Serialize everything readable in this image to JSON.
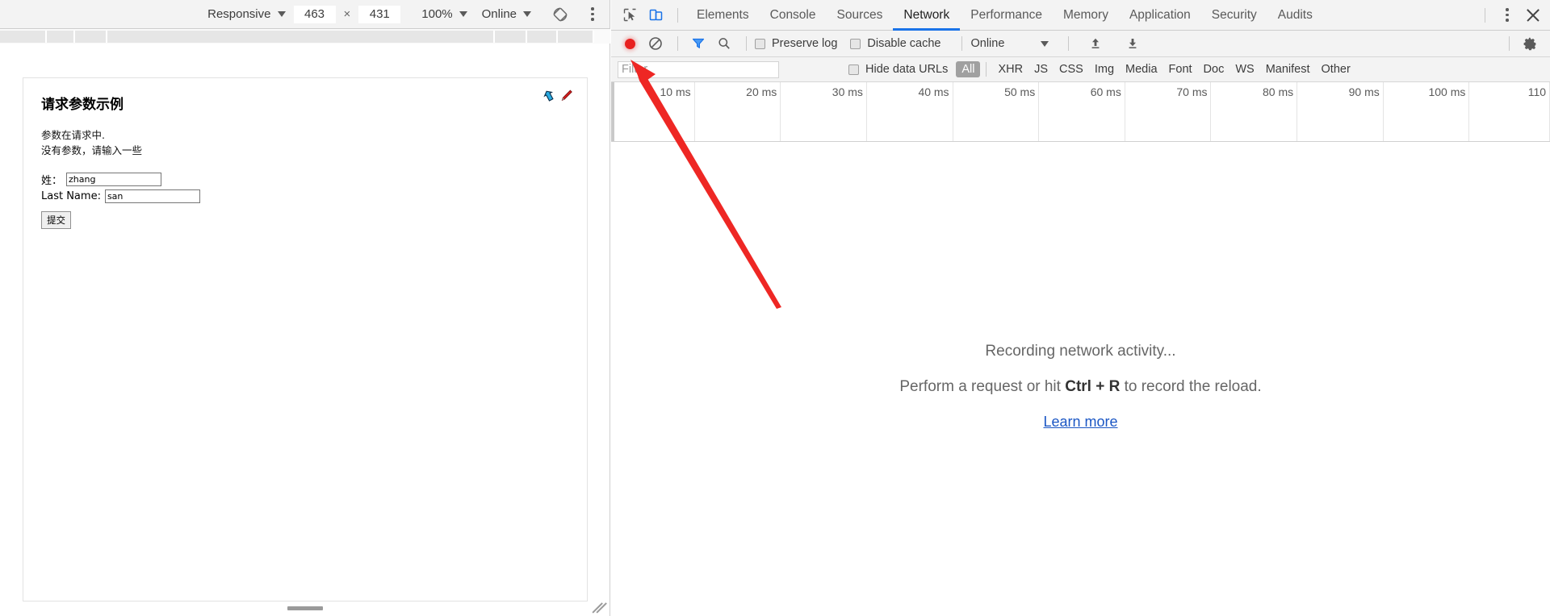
{
  "device_toolbar": {
    "device_label": "Responsive",
    "width": "463",
    "x_sep": "×",
    "height": "431",
    "zoom": "100%",
    "throttle": "Online",
    "rotate_icon": "rotate-device-icon",
    "menu_icon": "more-options-icon"
  },
  "page": {
    "title": "请求参数示例",
    "para_line1": "参数在请求中.",
    "para_line2": "没有参数，请输入一些",
    "fields": [
      {
        "label": "姓：",
        "value": "zhang",
        "name": "first-name"
      },
      {
        "label": "Last Name:",
        "value": "san",
        "name": "last-name"
      }
    ],
    "submit_label": "提交",
    "tool_icons": [
      "undo-arrow-icon",
      "red-pen-icon"
    ]
  },
  "devtools": {
    "inspect_icon": "inspect-element-icon",
    "device_toggle_icon": "toggle-device-toolbar-icon",
    "tabs": [
      {
        "label": "Elements",
        "active": false
      },
      {
        "label": "Console",
        "active": false
      },
      {
        "label": "Sources",
        "active": false
      },
      {
        "label": "Network",
        "active": true
      },
      {
        "label": "Performance",
        "active": false
      },
      {
        "label": "Memory",
        "active": false
      },
      {
        "label": "Application",
        "active": false
      },
      {
        "label": "Security",
        "active": false
      },
      {
        "label": "Audits",
        "active": false
      }
    ],
    "more_tabs_icon": "more-tools-icon",
    "close_icon": "close-devtools-icon"
  },
  "network_toolbar": {
    "record_icon": "record-button-icon",
    "clear_icon": "clear-requests-icon",
    "filter_icon": "filter-toggle-icon",
    "search_icon": "search-icon",
    "preserve_log_label": "Preserve log",
    "preserve_log_checked": false,
    "disable_cache_label": "Disable cache",
    "disable_cache_checked": false,
    "throttle_value": "Online",
    "import_icon": "import-har-icon",
    "export_icon": "export-har-icon",
    "settings_icon": "gear-icon"
  },
  "network_filterbar": {
    "filter_placeholder": "Filter",
    "filter_value": "",
    "hide_data_urls_label": "Hide data URLs",
    "hide_data_urls_checked": false,
    "types": [
      {
        "label": "All",
        "selected": true
      },
      {
        "label": "XHR",
        "selected": false
      },
      {
        "label": "JS",
        "selected": false
      },
      {
        "label": "CSS",
        "selected": false
      },
      {
        "label": "Img",
        "selected": false
      },
      {
        "label": "Media",
        "selected": false
      },
      {
        "label": "Font",
        "selected": false
      },
      {
        "label": "Doc",
        "selected": false
      },
      {
        "label": "WS",
        "selected": false
      },
      {
        "label": "Manifest",
        "selected": false
      },
      {
        "label": "Other",
        "selected": false
      }
    ]
  },
  "timeline": {
    "ticks": [
      "10 ms",
      "20 ms",
      "30 ms",
      "40 ms",
      "50 ms",
      "60 ms",
      "70 ms",
      "80 ms",
      "90 ms",
      "100 ms",
      "110"
    ]
  },
  "network_empty_state": {
    "line1": "Recording network activity...",
    "line2_pre": "Perform a request or hit ",
    "line2_key": "Ctrl + R",
    "line2_post": " to record the reload.",
    "learn_more": "Learn more"
  },
  "annotation": {
    "arrow_color": "#ee2724",
    "arrow_name": "red-pointer-arrow"
  },
  "colors": {
    "accent_blue": "#1a73e8",
    "record_red": "#e8201f",
    "link_blue": "#1a56c4",
    "toolbar_bg": "#f3f3f3"
  }
}
